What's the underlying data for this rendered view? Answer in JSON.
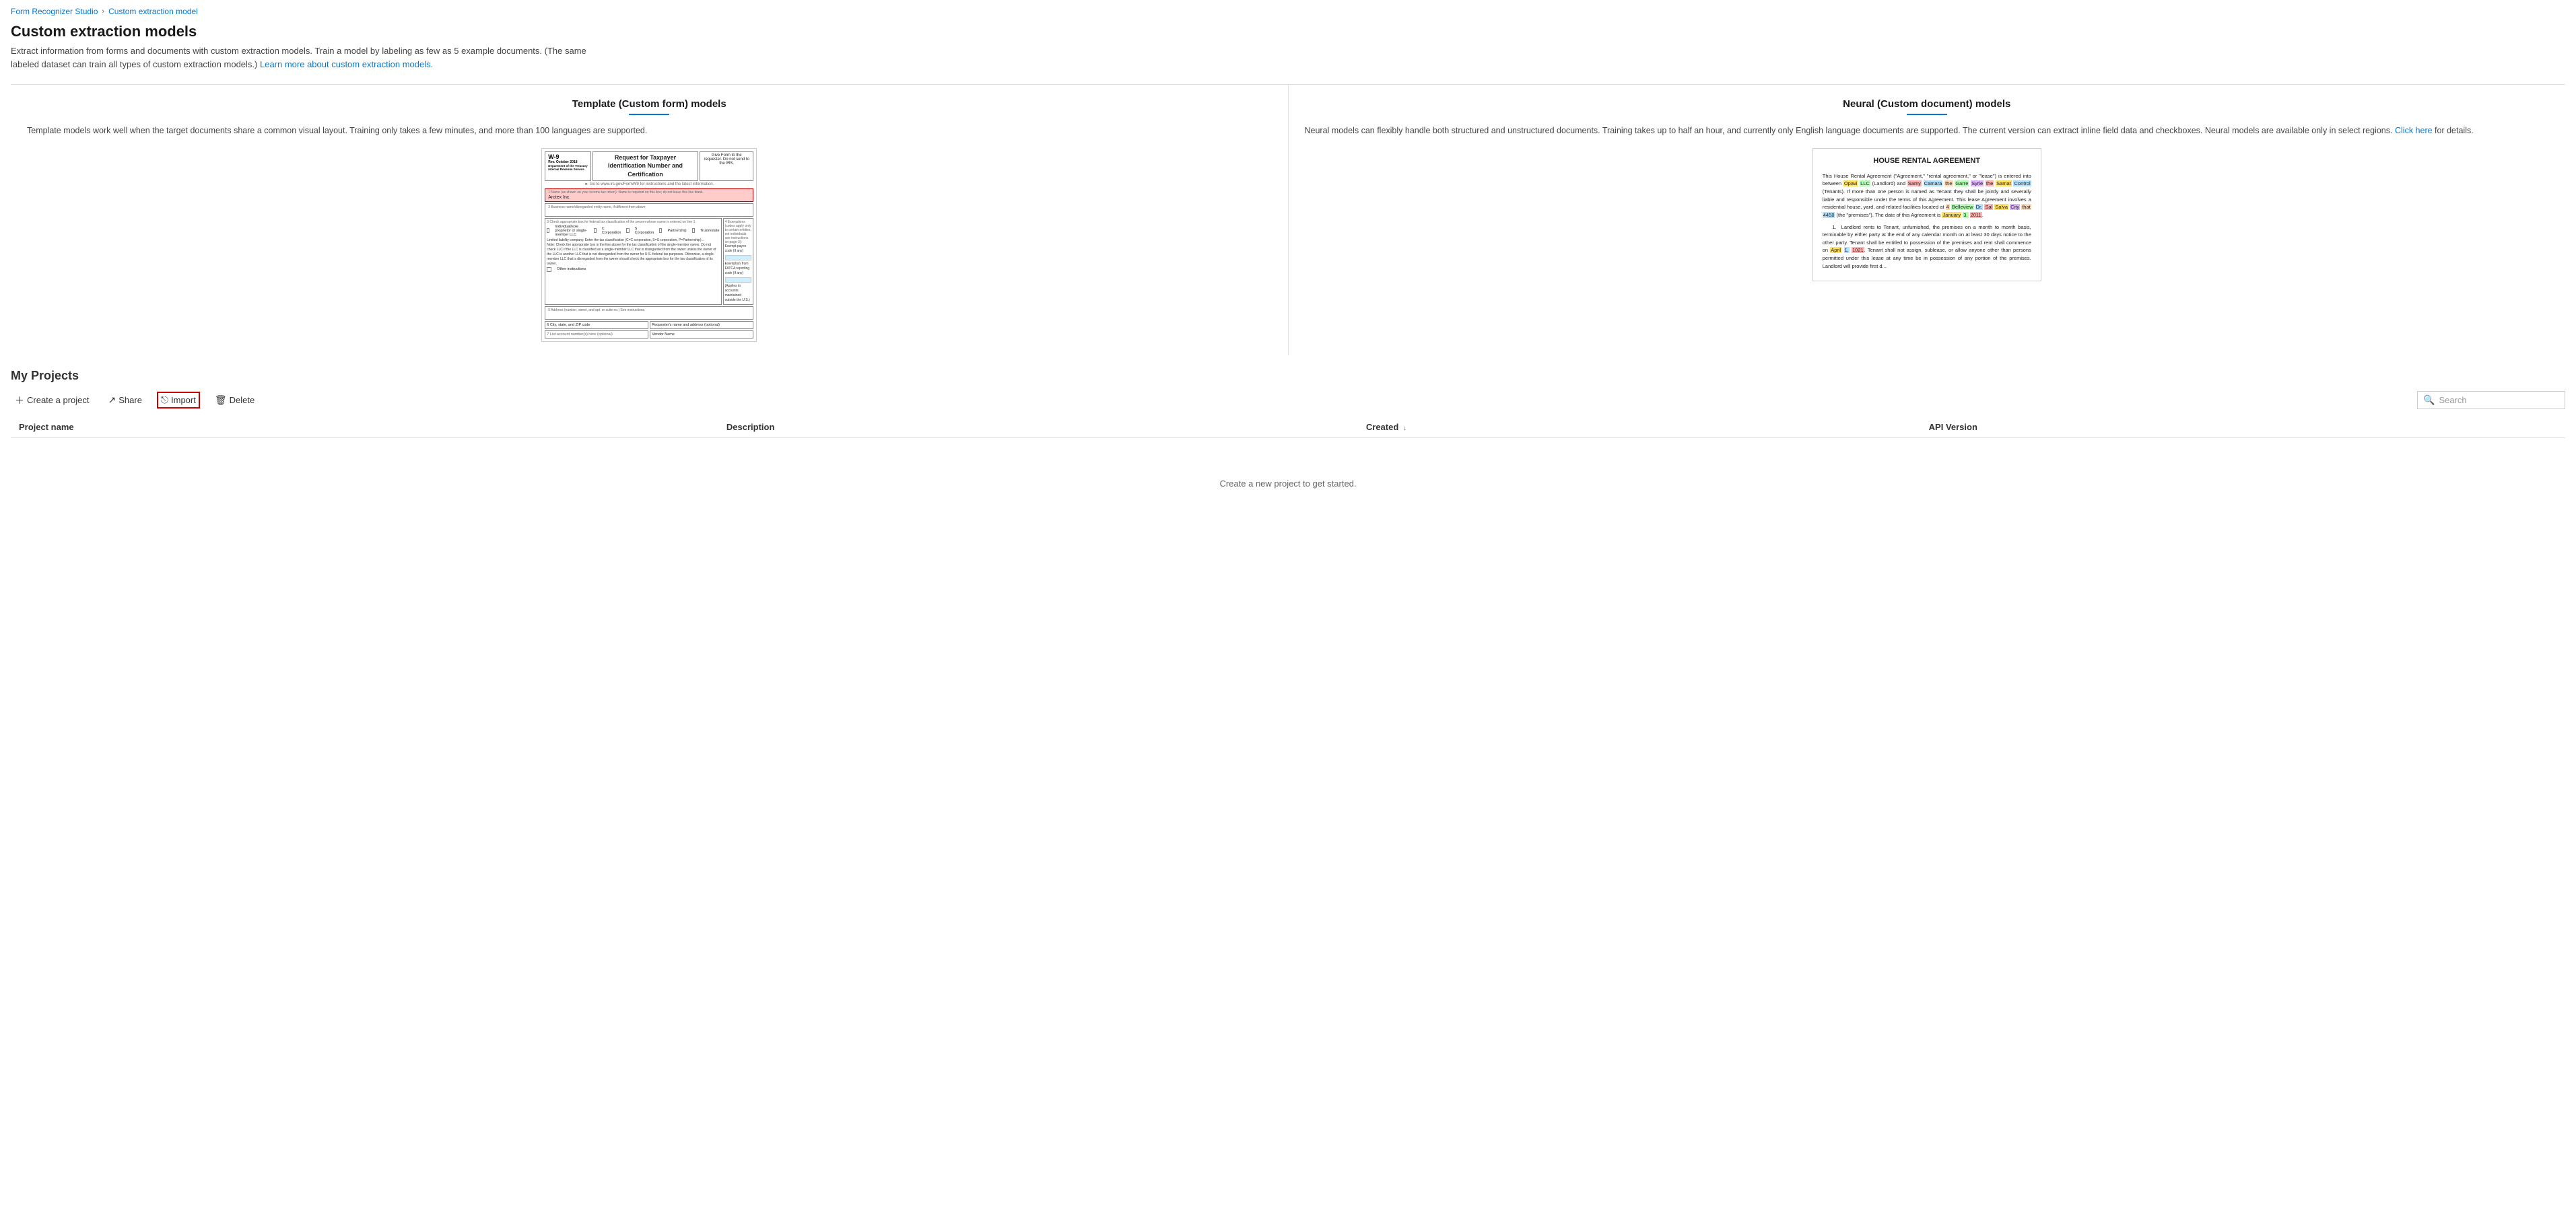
{
  "breadcrumb": {
    "home_label": "Form Recognizer Studio",
    "current_label": "Custom extraction model"
  },
  "header": {
    "title": "Custom extraction models",
    "description": "Extract information from forms and documents with custom extraction models. Train a model by labeling as few as 5 example documents. (The same labeled dataset can train all types of custom extraction models.)",
    "learn_more_text": "Learn more about custom extraction models.",
    "learn_more_url": "#"
  },
  "template_model": {
    "title": "Template (Custom form) models",
    "description": "Template models work well when the target documents share a common visual layout. Training only takes a few minutes, and more than 100 languages are supported."
  },
  "neural_model": {
    "title": "Neural (Custom document) models",
    "description": "Neural models can flexibly handle both structured and unstructured documents. Training takes up to half an hour, and currently only English language documents are supported. The current version can extract inline field data and checkboxes. Neural models are available only in select regions.",
    "click_here_text": "Click here",
    "for_details_text": "for details."
  },
  "toolbar": {
    "create_label": "Create a project",
    "share_label": "Share",
    "import_label": "Import",
    "delete_label": "Delete"
  },
  "search": {
    "placeholder": "Search"
  },
  "table": {
    "columns": [
      "Project name",
      "Description",
      "Created ↓",
      "API Version"
    ],
    "empty_message": "Create a new project to get started."
  },
  "projects_title": "My Projects",
  "w9": {
    "form_label": "Form W-9",
    "rev": "Rev. October 2018",
    "dept": "Department of the Treasury Internal Revenue Service",
    "title": "Request for Taxpayer Identification Number and Certification",
    "give_form": "Give Form to the requester. Do not send to the IRS.",
    "instruction_text": "► Go to www.irs.gov/FormW9 for instructions and the latest information.",
    "name_label": "1 Name (as shown on your income tax return). Name is required on this line; do not leave this line blank.",
    "name_value": "Arctex Inc.",
    "biz_label": "2 Business name/disregarded entity name, if different from above",
    "field3_label": "3 Check appropriate box for federal tax classification..."
  },
  "rental": {
    "title": "HOUSE RENTAL AGREEMENT",
    "para1": "This House Rental Agreement (\"Agreement,\" \"rental agreement,\" or \"lease\") is entered into between Opavi LLC (Landlord) and Samy Camara the Garre Syrie the Samat Control (Tenants). If more than one person is named as Tenant they shall be jointly and severally liable and responsible under the terms of this Agreement. This lease Agreement involves a residential house, yard, and related facilities located at 4 Belleview Dr. Sal Salva City that 4458 (the \"premises\"). The date of this Agreement is January 3, 2011.",
    "para2": "1. Landlord rents to Tenant, unfurnished, the premises on a month to month basis, terminable by either party at the end of any calendar month on at least 30 days notice to the other party. Tenant shall be entitled to possession of the premises and rent shall commence on April 1, 1021. Tenant shall not assign, sublease, or allow anyone other than persons permitted under this..."
  }
}
